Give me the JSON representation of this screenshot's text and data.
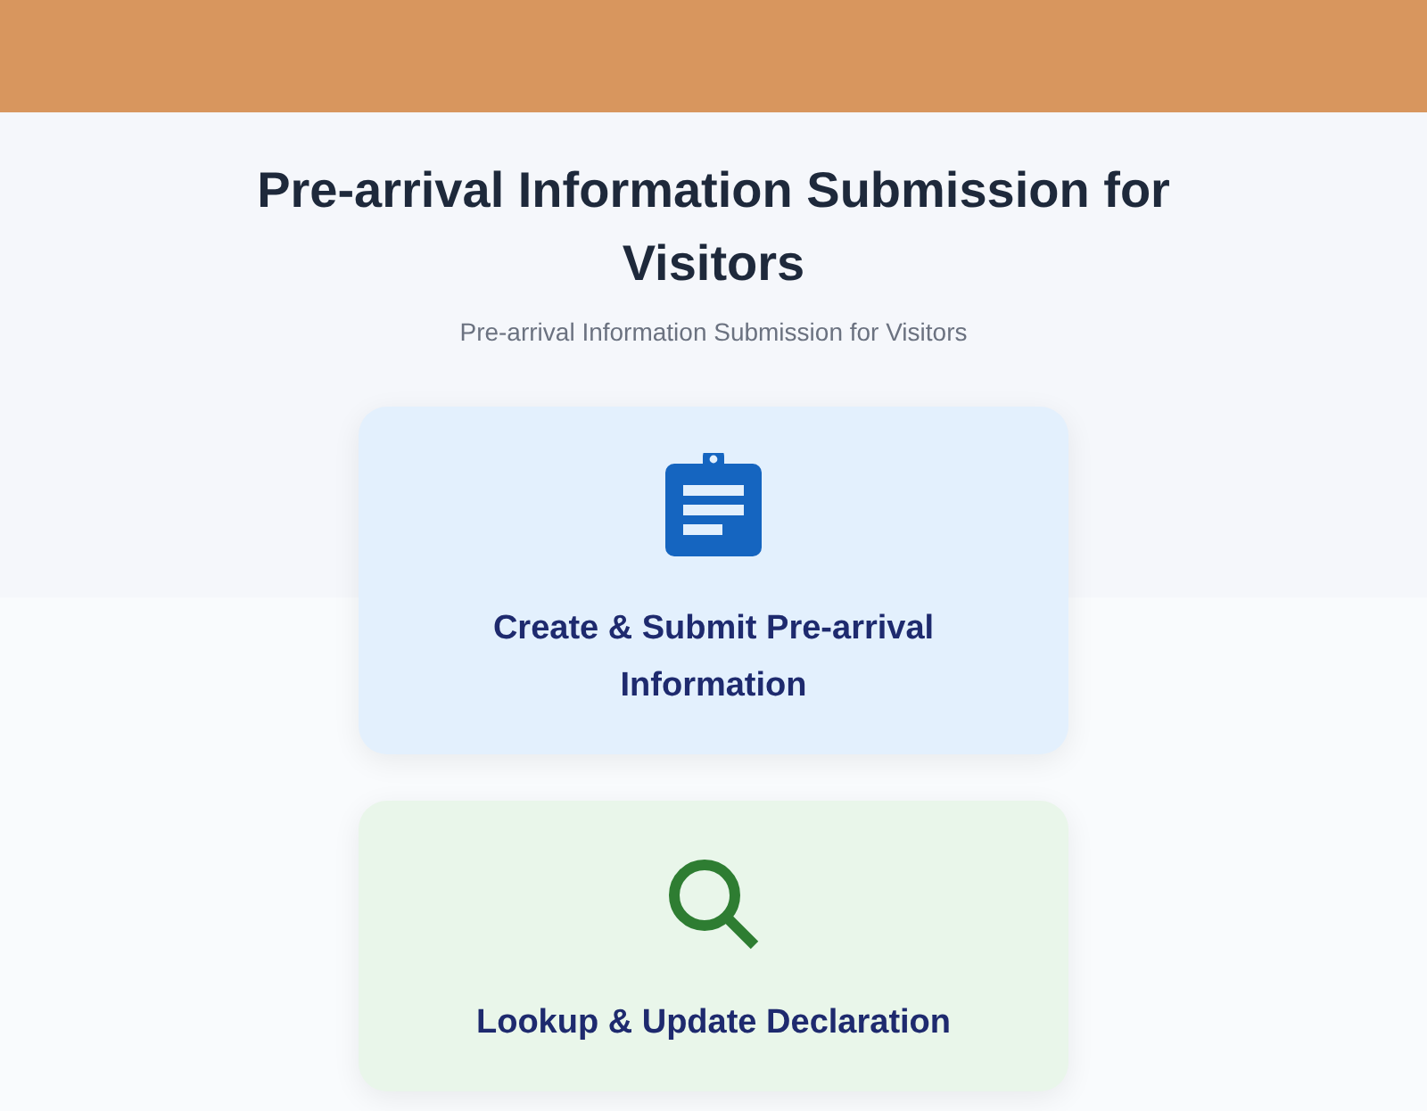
{
  "page": {
    "title": "Pre-arrival Information Submission for Visitors",
    "subtitle": "Pre-arrival Information Submission for Visitors"
  },
  "cards": [
    {
      "kind": "create",
      "label": "Create & Submit Pre-arrival Information"
    },
    {
      "kind": "lookup",
      "label": "Lookup & Update Declaration"
    }
  ]
}
